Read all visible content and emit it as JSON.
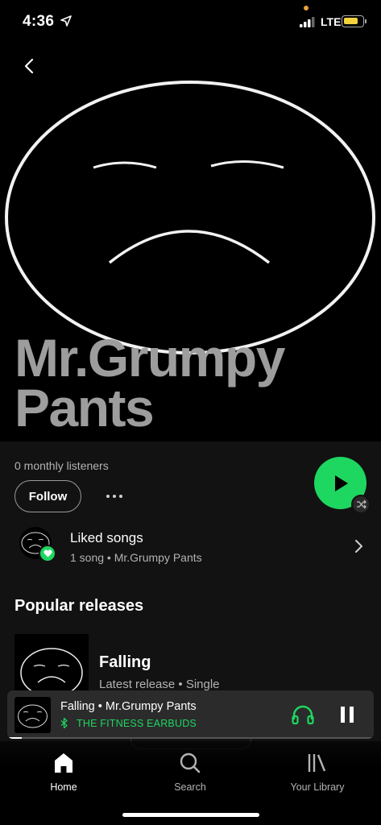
{
  "status_bar": {
    "time": "4:36",
    "network": "LTE",
    "battery_level": 0.8,
    "battery_color": "#f4d33c"
  },
  "header": {
    "back_icon": "chevron-left-icon"
  },
  "artist": {
    "name": "Mr.Grumpy Pants",
    "monthly_listeners": "0 monthly listeners",
    "follow_label": "Follow",
    "more_icon": "more-dots-icon",
    "play_icon": "play-icon",
    "shuffle_icon": "shuffle-icon"
  },
  "liked_songs": {
    "title": "Liked songs",
    "subtitle": "1 song • Mr.Grumpy Pants",
    "chevron_icon": "chevron-right-icon"
  },
  "popular_releases": {
    "title": "Popular releases",
    "items": [
      {
        "title": "Falling",
        "subtitle": "Latest release • Single"
      }
    ]
  },
  "now_playing": {
    "track": "Falling",
    "artist": "Mr.Grumpy Pants",
    "separator": " • ",
    "device": "THE FITNESS EARBUDS",
    "progress": 0.04,
    "accent": "#1ed760"
  },
  "tabs": [
    {
      "label": "Home",
      "icon": "home-icon",
      "active": true
    },
    {
      "label": "Search",
      "icon": "search-icon",
      "active": false
    },
    {
      "label": "Your Library",
      "icon": "library-icon",
      "active": false
    }
  ]
}
